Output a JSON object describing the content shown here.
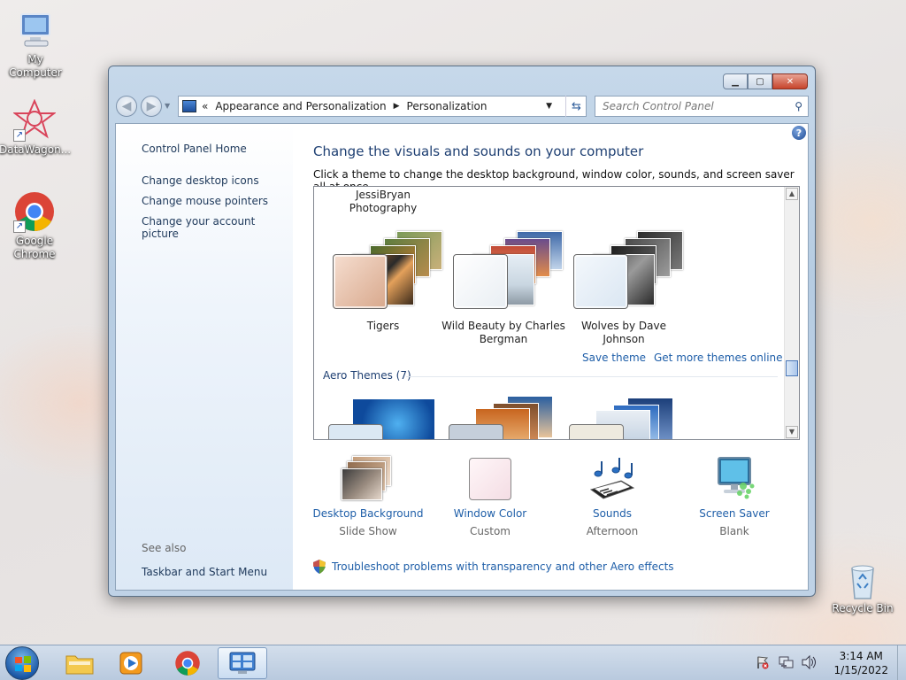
{
  "desktop": {
    "icons": [
      {
        "label": "My Computer"
      },
      {
        "label": "DataWagon..."
      },
      {
        "label": "Google Chrome"
      },
      {
        "label": "Recycle Bin"
      }
    ]
  },
  "window": {
    "nav": {
      "breadcrumb_sep": "«",
      "crumbs": [
        "Appearance and Personalization",
        "Personalization"
      ],
      "search_placeholder": "Search Control Panel"
    },
    "sidebar": {
      "home": "Control Panel Home",
      "links": [
        "Change desktop icons",
        "Change mouse pointers",
        "Change your account picture"
      ],
      "see_also": "See also",
      "see_also_links": [
        "Taskbar and Start Menu"
      ]
    },
    "main": {
      "title": "Change the visuals and sounds on your computer",
      "intro": "Click a theme to change the desktop background, window color, sounds, and screen saver all at once.",
      "partial_theme": "JessiBryan\nPhotography",
      "themes": [
        {
          "name": "Tigers"
        },
        {
          "name": "Wild Beauty by Charles Bergman"
        },
        {
          "name": "Wolves by Dave Johnson"
        }
      ],
      "save_theme": "Save theme",
      "get_more": "Get more themes online",
      "aero_group": "Aero Themes (7)",
      "tiles": [
        {
          "title": "Desktop Background",
          "sub": "Slide Show"
        },
        {
          "title": "Window Color",
          "sub": "Custom"
        },
        {
          "title": "Sounds",
          "sub": "Afternoon"
        },
        {
          "title": "Screen Saver",
          "sub": "Blank"
        }
      ],
      "troubleshoot": "Troubleshoot problems with transparency and other Aero effects"
    }
  },
  "taskbar": {
    "time": "3:14 AM",
    "date": "1/15/2022"
  },
  "colors": {
    "link": "#1e5ea8",
    "heading": "#1e3f72"
  }
}
